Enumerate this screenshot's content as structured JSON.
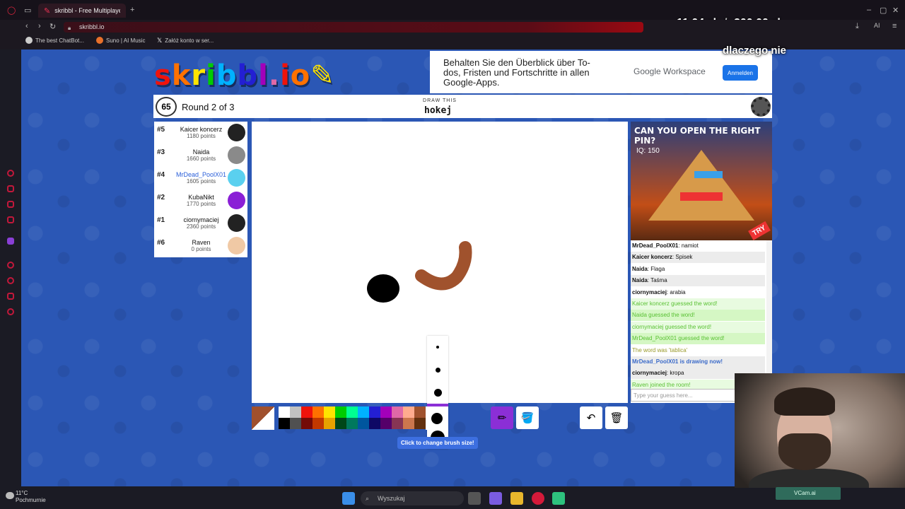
{
  "browser": {
    "tab_title": "skribbl - Free Multiplayer D",
    "url": "skribbl.io",
    "bookmarks": [
      "The best ChatBot...",
      "Suno | AI Music",
      "Załóż konto w ser..."
    ]
  },
  "overlay": {
    "amount_current": "11,04 zł",
    "separator": "/",
    "amount_goal": "200,00 zł",
    "question": "dlaczego nie"
  },
  "game": {
    "logo": "skribbl.io",
    "timer": "65",
    "round": "Round 2 of 3",
    "draw_this_label": "DRAW THIS",
    "word": "hokej"
  },
  "ad_top": {
    "text": "Behalten Sie den Überblick über To-dos, Fristen und Fortschritte in allen Google-Apps.",
    "brand": "Google Workspace",
    "button": "Anmelden"
  },
  "players": [
    {
      "rank": "#5",
      "name": "Kaicer koncerz",
      "points": "1180 points",
      "avatar": "#222222"
    },
    {
      "rank": "#3",
      "name": "Naida",
      "points": "1660 points",
      "avatar": "#8a8a8a"
    },
    {
      "rank": "#4",
      "name": "MrDead_PoolX01",
      "points": "1605 points",
      "avatar": "#5ad0ef",
      "me": true
    },
    {
      "rank": "#2",
      "name": "KubaNikt",
      "points": "1770 points",
      "avatar": "#8a1fd6"
    },
    {
      "rank": "#1",
      "name": "ciornymaciej",
      "points": "2360 points",
      "avatar": "#222222"
    },
    {
      "rank": "#6",
      "name": "Raven",
      "points": "0 points",
      "avatar": "#f0c9a5"
    }
  ],
  "ad_side": {
    "headline": "CAN YOU OPEN THE RIGHT PIN?",
    "iq": "IQ: 150",
    "cta": "TRY"
  },
  "chat": [
    {
      "user": "MrDead_PoolX01",
      "text": "namiot",
      "style": "normal"
    },
    {
      "user": "Kaicer koncerz",
      "text": "Spisek",
      "style": "alt"
    },
    {
      "user": "Naida",
      "text": "Flaga",
      "style": "normal"
    },
    {
      "user": "Naida",
      "text": "Taśma",
      "style": "alt"
    },
    {
      "user": "ciornymaciej",
      "text": "arabia",
      "style": "normal"
    },
    {
      "user": "",
      "text": "Kaicer koncerz guessed the word!",
      "style": "green"
    },
    {
      "user": "",
      "text": "Naida guessed the word!",
      "style": "green2"
    },
    {
      "user": "",
      "text": "ciornymaciej guessed the word!",
      "style": "green"
    },
    {
      "user": "",
      "text": "MrDead_PoolX01 guessed the word!",
      "style": "green2"
    },
    {
      "user": "",
      "text": "The word was 'tablica'",
      "style": "olive"
    },
    {
      "user": "",
      "text": "MrDead_PoolX01 is drawing now!",
      "style": "blue"
    },
    {
      "user": "ciornymaciej",
      "text": "kropa",
      "style": "normal"
    },
    {
      "user": "",
      "text": "Raven joined the room!",
      "style": "green"
    }
  ],
  "chat_placeholder": "Type your guess here...",
  "toolbar": {
    "current_color": "#a0502d",
    "palette_top": [
      "#ffffff",
      "#c1c1c1",
      "#ef130b",
      "#ff7100",
      "#ffe400",
      "#00cc00",
      "#00ff91",
      "#00b2ff",
      "#231fd3",
      "#a300ba",
      "#df69a7",
      "#ffac8e",
      "#a0522d"
    ],
    "palette_bottom": [
      "#000000",
      "#505050",
      "#740b07",
      "#c23800",
      "#e8a200",
      "#004619",
      "#00785d",
      "#00569e",
      "#0e0865",
      "#550069",
      "#873554",
      "#cc774d",
      "#63300d"
    ],
    "brush_tooltip": "Click to change brush size!",
    "pencil_key": "B",
    "fill_key": "F",
    "undo_key": "U",
    "clear_key": "C"
  },
  "taskbar": {
    "temperature": "11°C",
    "weather": "Pochmurnie",
    "search_placeholder": "Wyszukaj",
    "vcam": "VCam.ai"
  }
}
